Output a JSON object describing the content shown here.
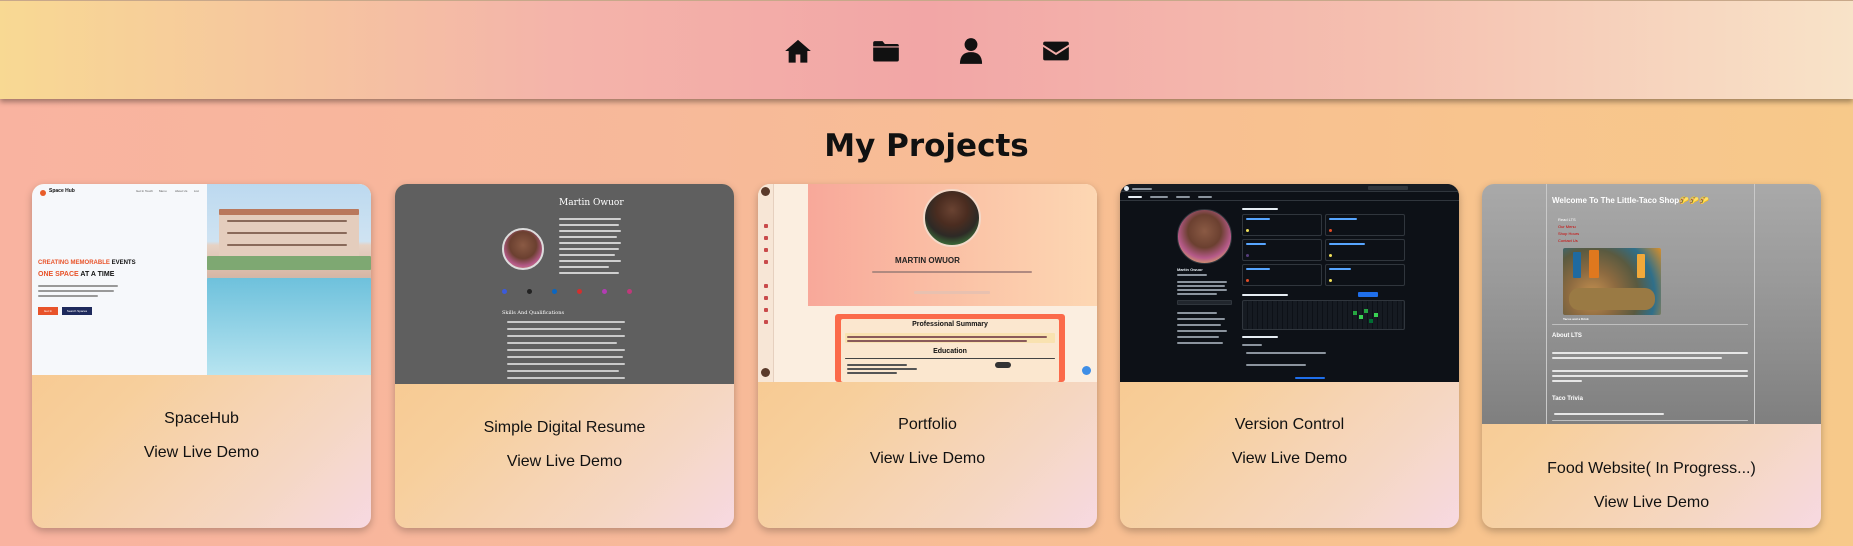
{
  "nav": {
    "items": [
      {
        "name": "home",
        "icon": "home-icon"
      },
      {
        "name": "projects",
        "icon": "folder-icon"
      },
      {
        "name": "about",
        "icon": "user-icon"
      },
      {
        "name": "contact",
        "icon": "envelope-icon"
      }
    ]
  },
  "page": {
    "title": "My Projects"
  },
  "cards": [
    {
      "title": "SpaceHub",
      "link": "View Live Demo",
      "preview": {
        "brand": "Space Hub",
        "nav_links": [
          "Get In Touch",
          "Menu",
          "About Us",
          "List"
        ],
        "headline_1": "CREATING MEMORABLE",
        "headline_1b": "EVENTS",
        "headline_2": "ONE SPACE",
        "headline_2b": "AT A TIME",
        "btn_1": "Get In",
        "btn_2": "Search Spaces"
      }
    },
    {
      "title": "Simple Digital Resume",
      "link": "View Live Demo",
      "preview": {
        "name": "Martin Owuor",
        "section": "Skills And Qualifications"
      }
    },
    {
      "title": "Portfolio",
      "link": "View Live Demo",
      "preview": {
        "name": "MARTIN OWUOR",
        "summary_heading": "Professional Summary",
        "education_heading": "Education"
      }
    },
    {
      "title": "Version Control",
      "link": "View Live Demo",
      "preview": {
        "profile_name": "Martin Owuor"
      }
    },
    {
      "title": "Food Website( In Progress...)",
      "link": "View Live Demo",
      "preview": {
        "heading": "Welcome To The Little-Taco Shop🌮🌮🌮",
        "links": [
          "Read LTS",
          "Our Menu",
          "Shop Hours",
          "Contact Us"
        ],
        "caption": "Tacos and a Drink",
        "about": "About LTS",
        "trivia": "Taco Trivia"
      }
    }
  ]
}
